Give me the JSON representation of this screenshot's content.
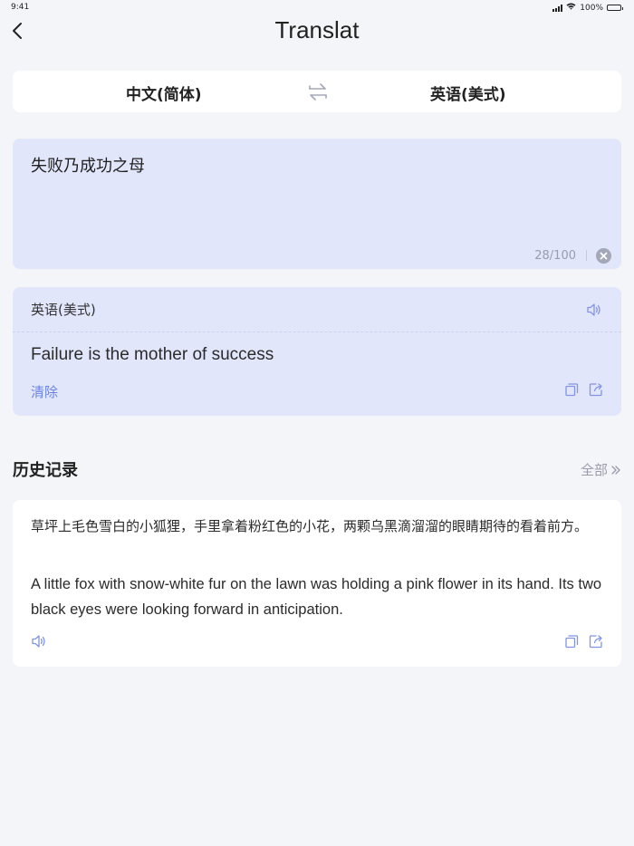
{
  "status_bar": {
    "time": "9:41",
    "battery": "100%"
  },
  "nav": {
    "title": "Translat",
    "back_icon": "chevron-left-icon"
  },
  "languages": {
    "source": "中文(简体)",
    "target": "英语(美式)",
    "swap_icon": "swap-icon"
  },
  "input": {
    "text": "失败乃成功之母",
    "count": "28/100",
    "clear_icon": "close-circle-icon"
  },
  "result": {
    "language": "英语(美式)",
    "text": "Failure is the mother of success",
    "clear_label": "清除",
    "speaker_icon": "speaker-icon",
    "copy_icon": "copy-icon",
    "share_icon": "share-icon"
  },
  "history": {
    "title": "历史记录",
    "all_label": "全部",
    "items": [
      {
        "source": "草坪上毛色雪白的小狐狸，手里拿着粉红色的小花，两颗乌黑滴溜溜的眼睛期待的看着前方。",
        "translation": "A little fox with snow-white fur on the lawn was holding a pink flower in its hand. Its two black eyes were looking forward in anticipation."
      }
    ]
  },
  "colors": {
    "background": "#f4f5f9",
    "panel": "#e2e6fb",
    "accent": "#6b83e3",
    "icon": "#8194e6",
    "muted": "#9a9cab"
  }
}
